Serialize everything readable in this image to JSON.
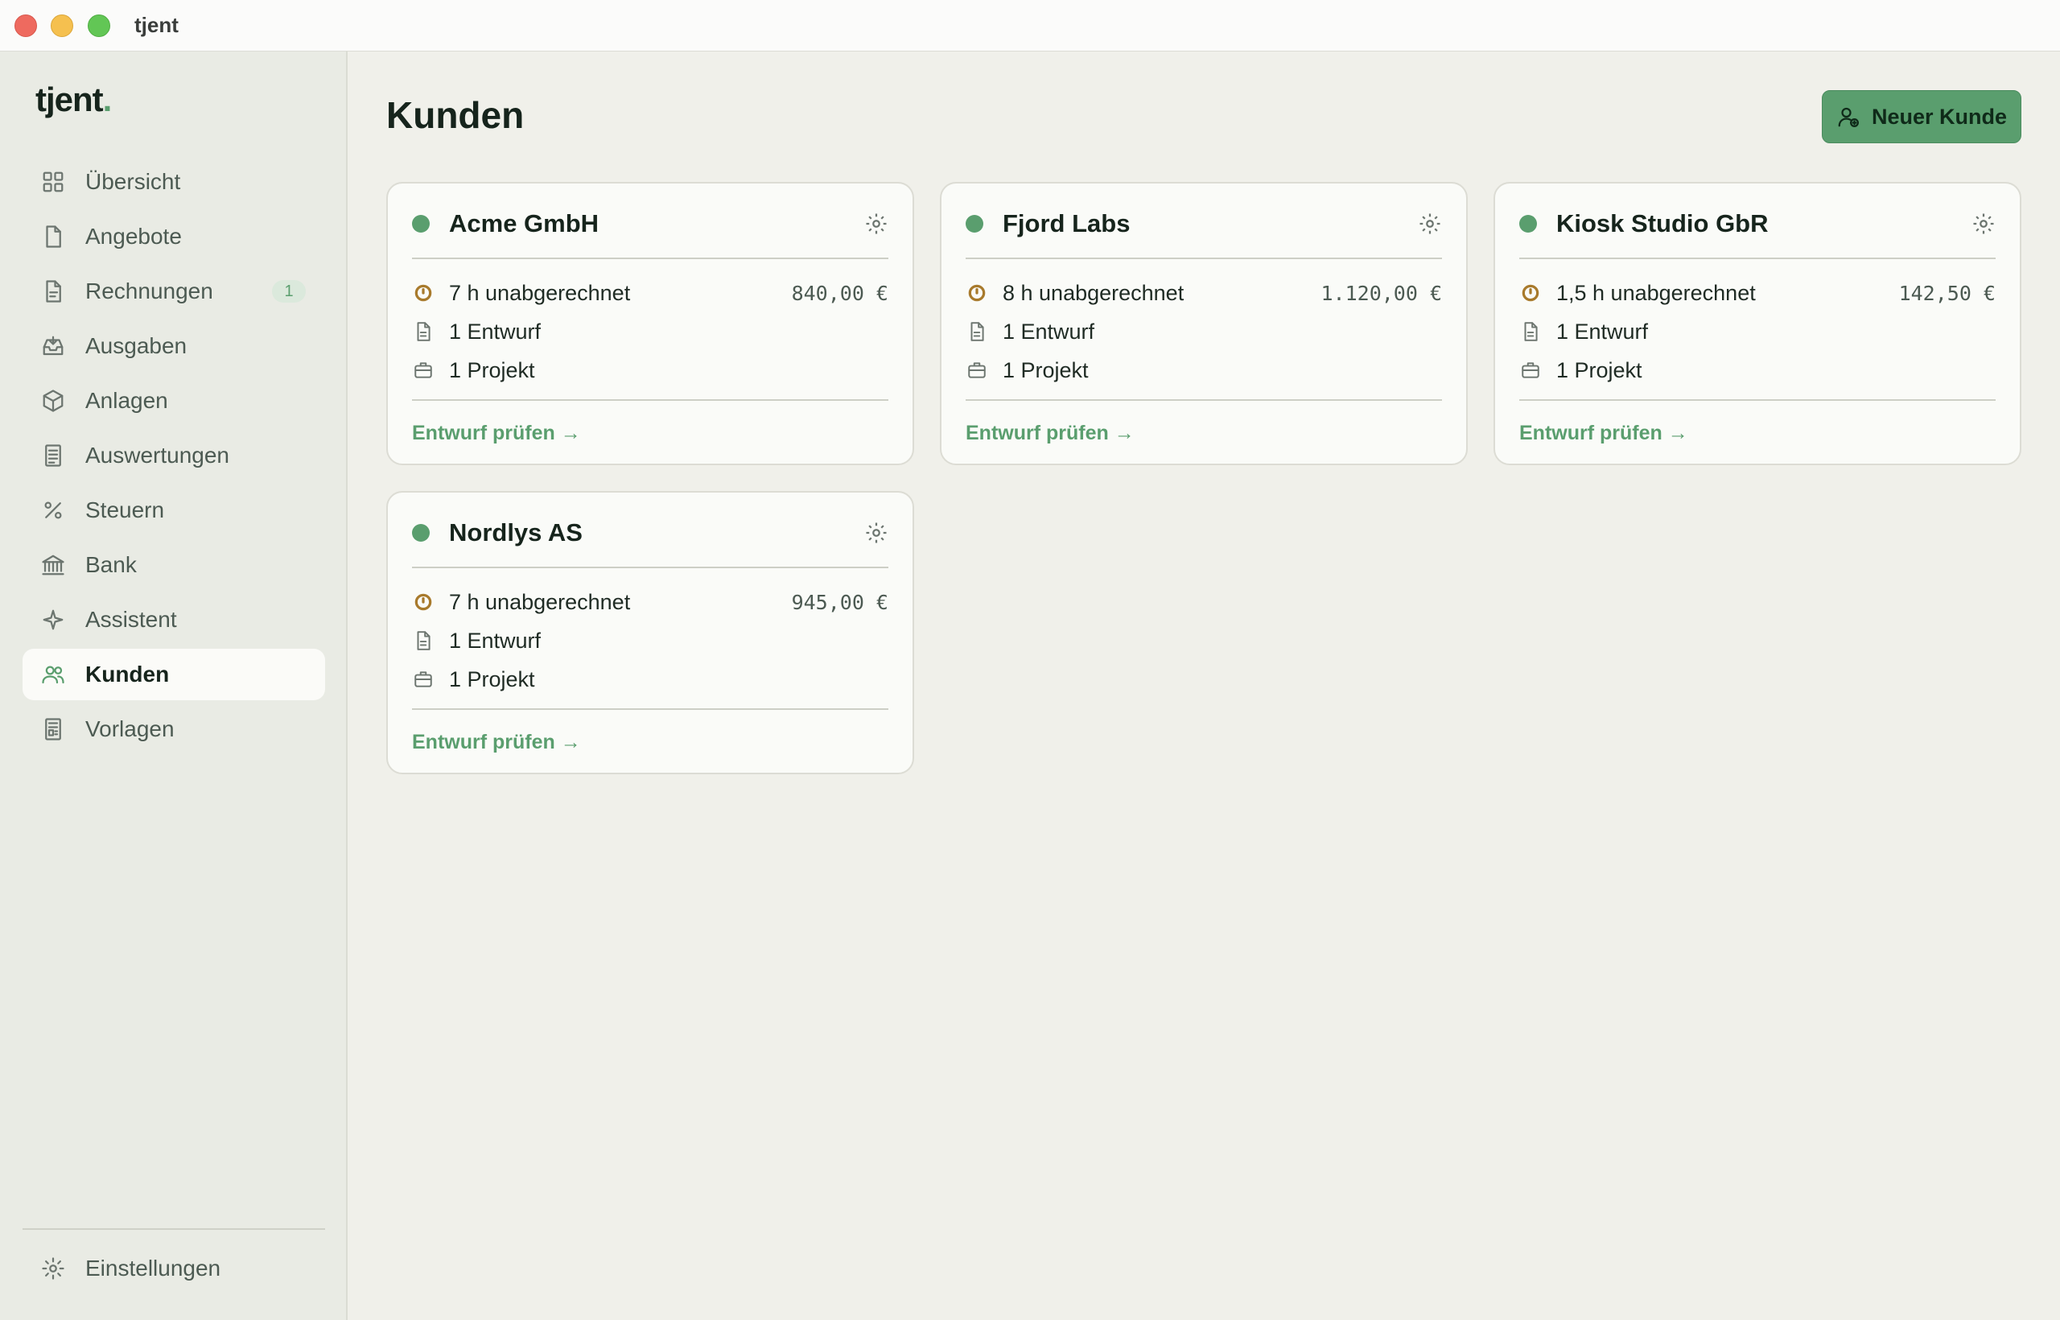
{
  "window": {
    "title": "tjent"
  },
  "brand": {
    "name": "tjent",
    "dot": ".",
    "accent": "#5a9e6e"
  },
  "sidebar": {
    "items": [
      {
        "label": "Übersicht",
        "icon": "grid-icon"
      },
      {
        "label": "Angebote",
        "icon": "document-icon"
      },
      {
        "label": "Rechnungen",
        "icon": "invoice-icon",
        "badge": "1"
      },
      {
        "label": "Ausgaben",
        "icon": "inbox-icon"
      },
      {
        "label": "Anlagen",
        "icon": "box-icon"
      },
      {
        "label": "Auswertungen",
        "icon": "report-icon"
      },
      {
        "label": "Steuern",
        "icon": "percent-icon"
      },
      {
        "label": "Bank",
        "icon": "bank-icon"
      },
      {
        "label": "Assistent",
        "icon": "sparkle-icon"
      },
      {
        "label": "Kunden",
        "icon": "users-icon",
        "active": true
      },
      {
        "label": "Vorlagen",
        "icon": "template-icon"
      }
    ],
    "settings_label": "Einstellungen"
  },
  "main": {
    "title": "Kunden",
    "new_button_label": "Neuer Kunde"
  },
  "customers": [
    {
      "name": "Acme GmbH",
      "unbilled": "7 h unabgerechnet",
      "amount": "840,00 €",
      "drafts": "1 Entwurf",
      "projects": "1 Projekt",
      "link": "Entwurf prüfen →"
    },
    {
      "name": "Fjord Labs",
      "unbilled": "8 h unabgerechnet",
      "amount": "1.120,00 €",
      "drafts": "1 Entwurf",
      "projects": "1 Projekt",
      "link": "Entwurf prüfen →"
    },
    {
      "name": "Kiosk Studio GbR",
      "unbilled": "1,5 h unabgerechnet",
      "amount": "142,50 €",
      "drafts": "1 Entwurf",
      "projects": "1 Projekt",
      "link": "Entwurf prüfen →"
    },
    {
      "name": "Nordlys AS",
      "unbilled": "7 h unabgerechnet",
      "amount": "945,00 €",
      "drafts": "1 Entwurf",
      "projects": "1 Projekt",
      "link": "Entwurf prüfen →"
    }
  ]
}
